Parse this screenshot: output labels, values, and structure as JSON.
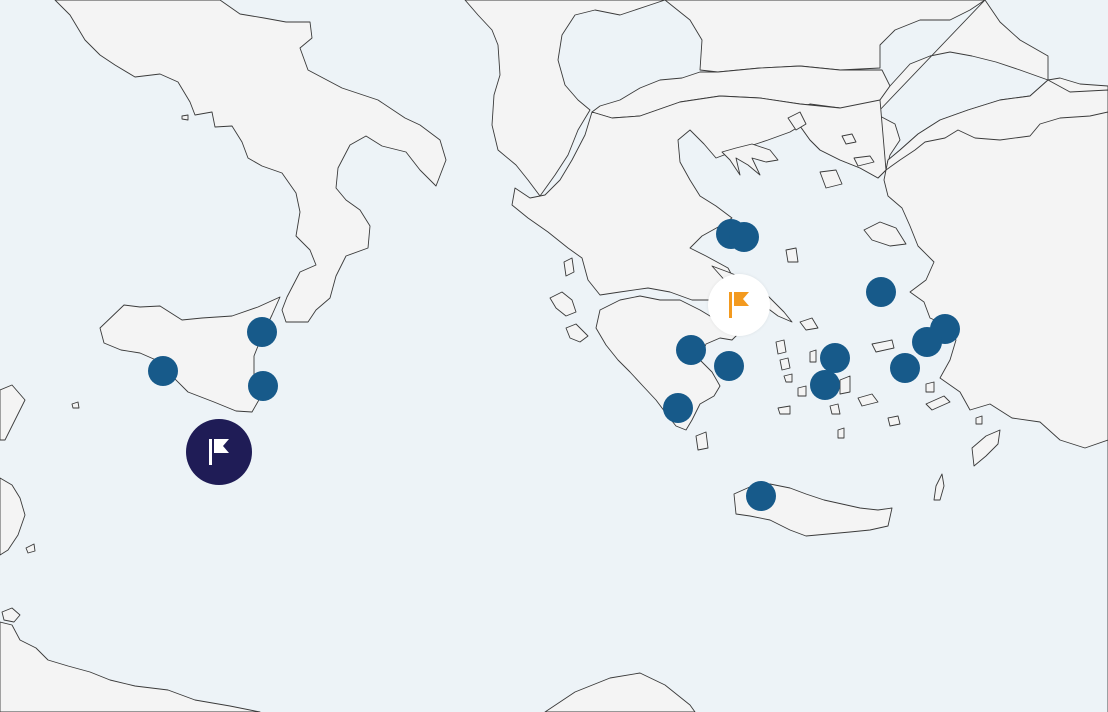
{
  "map": {
    "colors": {
      "sea": "#edf3f7",
      "land": "#f4f4f4",
      "border": "#3a3a3a",
      "marker": "#175a8a",
      "active_flag_bg": "#1f1c56",
      "active_flag_icon": "#ffffff",
      "highlight_flag_bg": "#ffffff",
      "highlight_flag_icon": "#f39a1f"
    },
    "markers": [
      {
        "name": "location-marker",
        "region": "sicily"
      },
      {
        "name": "location-marker",
        "region": "sicily"
      },
      {
        "name": "location-marker",
        "region": "sicily"
      },
      {
        "name": "location-marker",
        "region": "thessaly"
      },
      {
        "name": "location-marker",
        "region": "thessaly"
      },
      {
        "name": "location-marker",
        "region": "peloponnese"
      },
      {
        "name": "location-marker",
        "region": "peloponnese"
      },
      {
        "name": "location-marker",
        "region": "peloponnese"
      },
      {
        "name": "location-marker",
        "region": "cyclades"
      },
      {
        "name": "location-marker",
        "region": "cyclades"
      },
      {
        "name": "location-marker",
        "region": "turkey-coast"
      },
      {
        "name": "location-marker",
        "region": "turkey-coast"
      },
      {
        "name": "location-marker",
        "region": "dodecanese"
      },
      {
        "name": "location-marker",
        "region": "dodecanese"
      },
      {
        "name": "location-marker",
        "region": "crete"
      }
    ],
    "flags": [
      {
        "name": "active-flag-marker",
        "icon": "flag-icon",
        "style": "dark"
      },
      {
        "name": "highlighted-flag-marker",
        "icon": "flag-icon",
        "style": "light"
      }
    ]
  }
}
